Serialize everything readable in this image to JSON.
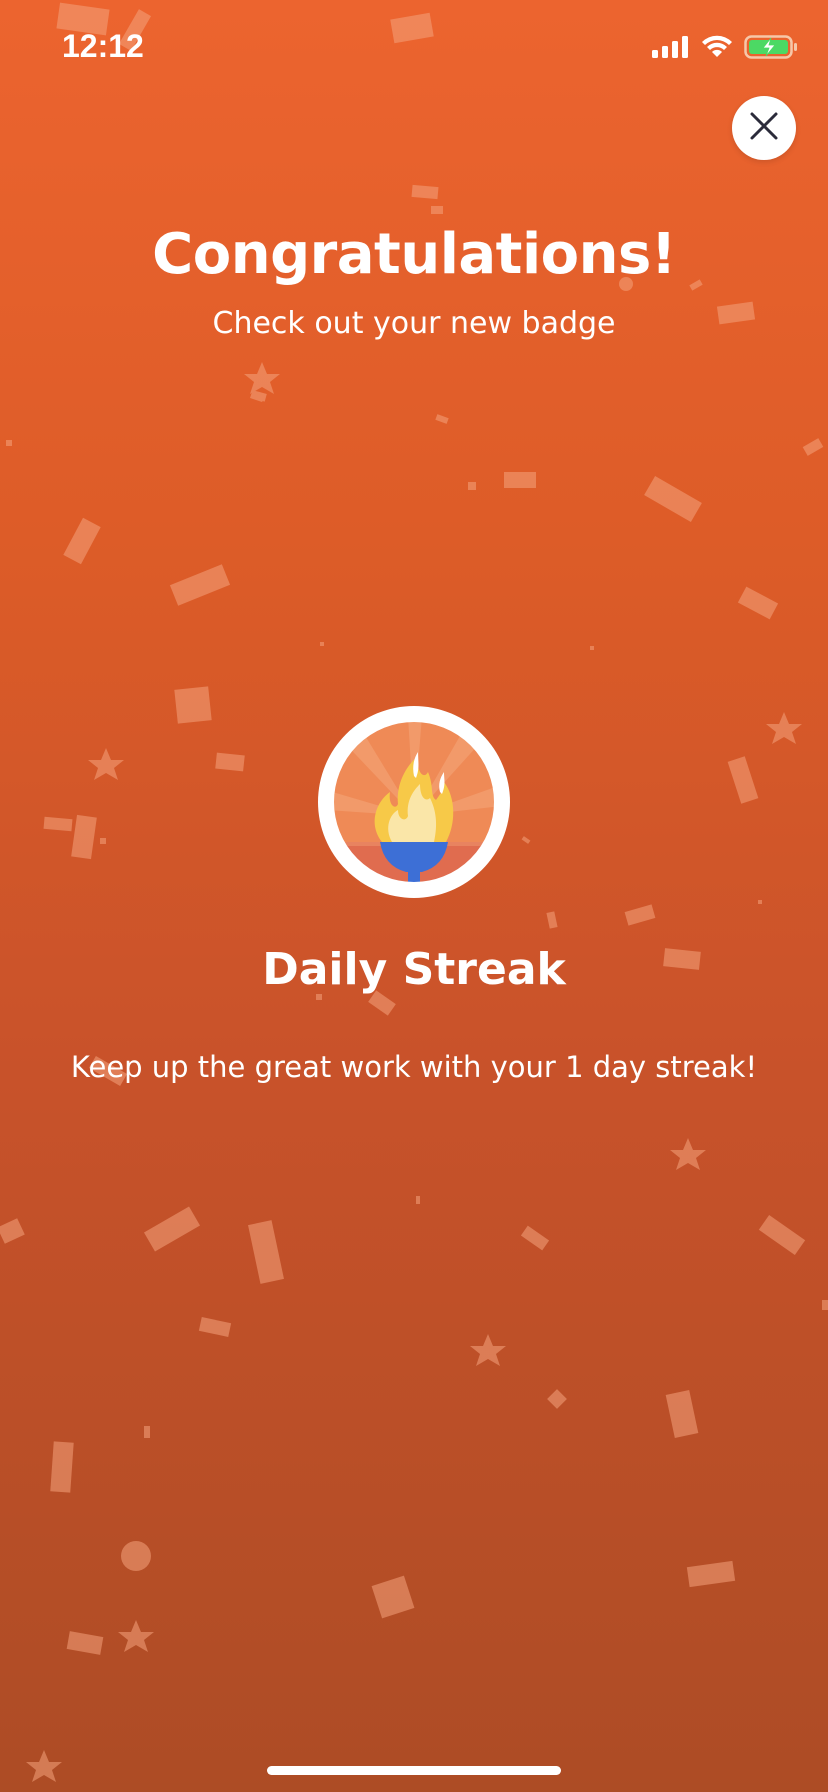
{
  "status_bar": {
    "time": "12:12",
    "icons": [
      "cellular-signal-icon",
      "wifi-icon",
      "battery-charging-icon"
    ],
    "battery_color": "#4cd964"
  },
  "close_button": {
    "icon": "close-icon"
  },
  "header": {
    "title": "Congratulations!",
    "subtitle": "Check out your new badge"
  },
  "badge": {
    "icon": "torch-flame-icon",
    "title": "Daily Streak",
    "description": "Keep up the great work with your 1 day streak!"
  },
  "colors": {
    "background_top": "#ec642f",
    "background_bottom": "#ad4c25",
    "text": "#ffffff",
    "flame_yellow": "#f7c948",
    "flame_light": "#fae6a8",
    "torch_blue": "#3d6fd6"
  }
}
